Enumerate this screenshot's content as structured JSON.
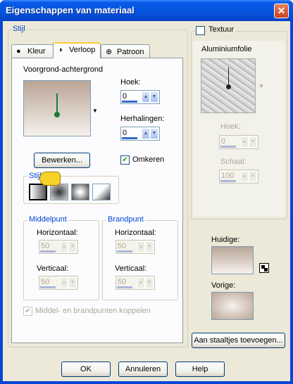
{
  "window": {
    "title": "Eigenschappen van materiaal",
    "close_glyph": "✕"
  },
  "stijl_group": {
    "label": "Stijl",
    "tabs": [
      {
        "label": "Kleur",
        "icon": "filled-circle-icon"
      },
      {
        "label": "Verloop",
        "icon": "half-circle-icon"
      },
      {
        "label": "Patroon",
        "icon": "pattern-icon"
      }
    ],
    "gradient_name": "Voorgrond-achtergrond",
    "hoek_label": "Hoek:",
    "hoek_value": "0",
    "herhalingen_label": "Herhalingen:",
    "herhalingen_value": "0",
    "bewerken_label": "Bewerken...",
    "omkeren_label": "Omkeren",
    "omkeren_checked": true,
    "stijl_sub_label": "Stijl",
    "middelpunt": {
      "label": "Middelpunt",
      "h_label": "Horizontaal:",
      "h_value": "50",
      "v_label": "Verticaal:",
      "v_value": "50"
    },
    "brandpunt": {
      "label": "Brandpunt",
      "h_label": "Horizontaal:",
      "h_value": "50",
      "v_label": "Verticaal:",
      "v_value": "50"
    },
    "koppelen_label": "Middel- en brandpunten koppelen"
  },
  "textuur_group": {
    "label": "Textuur",
    "checked": false,
    "texture_name": "Aluminiumfolie",
    "hoek_label": "Hoek:",
    "hoek_value": "0",
    "schaal_label": "Schaal:",
    "schaal_value": "100"
  },
  "huidige_label": "Huidige:",
  "vorige_label": "Vorige:",
  "aan_staaltjes_label": "Aan staaltjes toevoegen...",
  "footer": {
    "ok": "OK",
    "annuleren": "Annuleren",
    "help": "Help"
  },
  "colors": {
    "gradient_top": "#b8a596",
    "gradient_bottom": "#f7f1ec",
    "accent": "#0046d5"
  }
}
